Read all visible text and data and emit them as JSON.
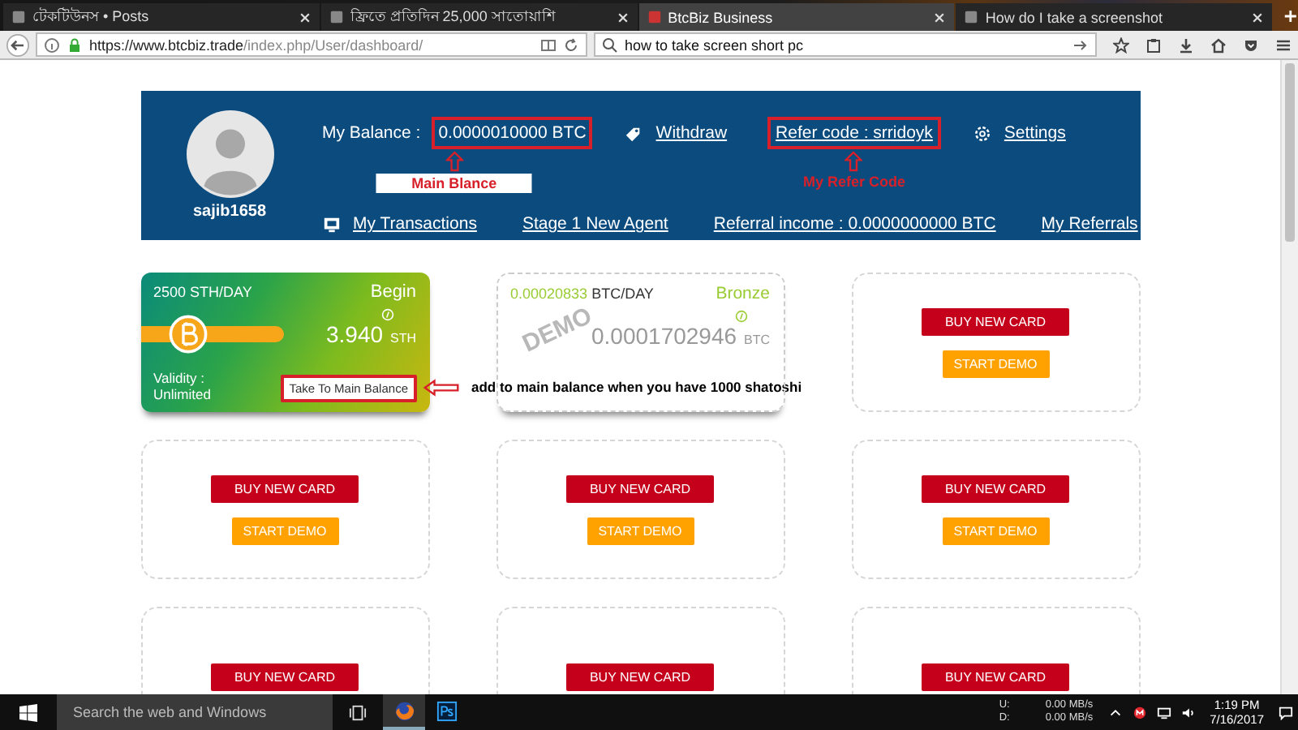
{
  "browser": {
    "tabs": [
      {
        "label": "টেকটিউনস • Posts",
        "selected": false
      },
      {
        "label": "ফ্রিতে প্রতিদিন 25,000 সাতোয়াশি",
        "selected": false
      },
      {
        "label": "BtcBiz Business",
        "selected": true
      },
      {
        "label": "How do I take a screenshot",
        "selected": false
      }
    ],
    "address": {
      "host": "https://www.btcbiz.trade",
      "path": "/index.php/User/dashboard/"
    },
    "search": {
      "value": "how to take screen short pc"
    }
  },
  "header": {
    "username": "sajib1658",
    "row_1": [
      {
        "kind": "balance",
        "label": "My Balance :",
        "value": "0.0000010000 BTC",
        "highlighted": true,
        "note": "Main Blance"
      },
      {
        "kind": "withdraw",
        "label": "Withdraw",
        "highlighted": false
      },
      {
        "kind": "plain",
        "label": "Refer code : srridoyk",
        "highlighted": true,
        "note": "My Refer Code"
      },
      {
        "kind": "settings",
        "label": "Settings",
        "highlighted": false
      }
    ],
    "row_2": [
      {
        "kind": "transactions",
        "label": "My Transactions",
        "highlighted": false
      },
      {
        "kind": "plain",
        "label": "Stage 1 New Agent",
        "highlighted": false
      },
      {
        "kind": "plain",
        "label": "Referral income : 0.0000000000 BTC",
        "highlighted": false
      },
      {
        "kind": "plain",
        "label": "My Referrals",
        "highlighted": false
      }
    ]
  },
  "cards": [
    {
      "kind": "active",
      "rate": "2500 STH/DAY",
      "tier": "Begin",
      "amount": "3.940",
      "unit": "STH",
      "validity": [
        "Validity :",
        "Unlimited"
      ],
      "button": "Take To Main Balance",
      "highlighted": true,
      "note": "add to main balance when you have 1000 shatoshi"
    },
    {
      "kind": "demo",
      "rate_value": "0.00020833",
      "rate_unit": "BTC/DAY",
      "tier": "Bronze",
      "amount": "0.0001702946",
      "unit": "BTC",
      "stamp": "DEMO"
    },
    {
      "kind": "empty",
      "buttons": [
        {
          "kind": "buy",
          "label": "BUY NEW CARD"
        },
        {
          "kind": "demo",
          "label": "START DEMO"
        }
      ]
    },
    {
      "kind": "empty",
      "buttons": [
        {
          "kind": "buy",
          "label": "BUY NEW CARD"
        },
        {
          "kind": "demo",
          "label": "START DEMO"
        }
      ]
    },
    {
      "kind": "empty",
      "buttons": [
        {
          "kind": "buy",
          "label": "BUY NEW CARD"
        },
        {
          "kind": "demo",
          "label": "START DEMO"
        }
      ]
    },
    {
      "kind": "empty",
      "buttons": [
        {
          "kind": "buy",
          "label": "BUY NEW CARD"
        },
        {
          "kind": "demo",
          "label": "START DEMO"
        }
      ]
    },
    {
      "kind": "empty",
      "buttons": [
        {
          "kind": "buy",
          "label": "BUY NEW CARD"
        }
      ]
    },
    {
      "kind": "empty",
      "buttons": [
        {
          "kind": "buy",
          "label": "BUY NEW CARD"
        }
      ]
    },
    {
      "kind": "empty",
      "buttons": [
        {
          "kind": "buy",
          "label": "BUY NEW CARD"
        }
      ]
    }
  ],
  "taskbar": {
    "search": {
      "placeholder": "Search the web and Windows"
    },
    "apps": [
      {
        "kind": "firefox",
        "active": true
      },
      {
        "kind": "photoshop",
        "active": false
      }
    ],
    "network": [
      {
        "label": "U:",
        "speed": "0.00 MB/s"
      },
      {
        "label": "D:",
        "speed": "0.00 MB/s"
      }
    ],
    "time": "1:19 PM",
    "date": "7/16/2017"
  }
}
